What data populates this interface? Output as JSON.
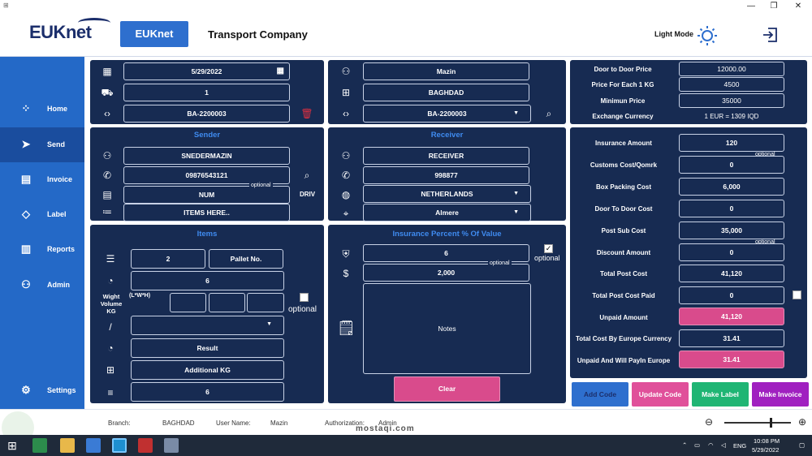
{
  "window": {
    "min": "—",
    "max": "❐",
    "close": "✕"
  },
  "header": {
    "logo": "EUKnet",
    "button": "EUKnet",
    "title": "Transport Company",
    "light_mode": "Light Mode"
  },
  "sidebar": {
    "items": [
      {
        "label": "Home",
        "icon": "⁘"
      },
      {
        "label": "Send",
        "icon": "➤"
      },
      {
        "label": "Invoice",
        "icon": "▤"
      },
      {
        "label": "Label",
        "icon": "◇"
      },
      {
        "label": "Reports",
        "icon": "▥"
      },
      {
        "label": "Admin",
        "icon": "⚇"
      },
      {
        "label": "Settings",
        "icon": "⚙"
      }
    ]
  },
  "top_left": {
    "date": "5/29/2022",
    "count": "1",
    "code": "BA-2200003"
  },
  "top_mid": {
    "user": "Mazin",
    "branch": "BAGHDAD",
    "code": "BA-2200003"
  },
  "prices": {
    "door_label": "Door to Door Price",
    "door_value": "12000.00",
    "per_kg_label": "Price For Each 1 KG",
    "per_kg_value": "4500",
    "min_label": "Minimun Price",
    "min_value": "35000",
    "exchange_label": "Exchange Currency",
    "exchange_value": "1 EUR = 1309 IQD"
  },
  "sender": {
    "title": "Sender",
    "name": "SNEDERMAZIN",
    "phone": "09876543121",
    "num": "NUM",
    "optional": "optional",
    "driv": "DRIV",
    "items": "ITEMS HERE.."
  },
  "receiver": {
    "title": "Receiver",
    "name": "RECEIVER",
    "phone": "998877",
    "country": "NETHERLANDS",
    "city": "Almere"
  },
  "items": {
    "title": "Items",
    "count": "2",
    "pallet": "Pallet No.",
    "weight": "6",
    "weight_label": "Wight Volume KG",
    "lwh": "(L*W*H)",
    "optional": "optional",
    "slash": "/",
    "result": "Result",
    "additional": "Additional KG",
    "total": "6"
  },
  "insurance": {
    "title": "Insurance Percent % Of Value",
    "percent": "6",
    "optional_chk": "optional",
    "value": "2,000",
    "optional": "optional",
    "notes": "Notes",
    "clear": "Clear"
  },
  "costs": {
    "rows": [
      {
        "label": "Insurance Amount",
        "value": "120"
      },
      {
        "label": "Customs Cost/Qomrk",
        "value": "0"
      },
      {
        "label": "Box Packing Cost",
        "value": "6,000"
      },
      {
        "label": "Door To Door Cost",
        "value": "0"
      },
      {
        "label": "Post Sub Cost",
        "value": "35,000"
      },
      {
        "label": "Discount Amount",
        "value": "0"
      },
      {
        "label": "Total Post Cost",
        "value": "41,120"
      },
      {
        "label": "Total Post Cost Paid",
        "value": "0"
      },
      {
        "label": "Unpaid Amount",
        "value": "41,120"
      },
      {
        "label": "Total Cost By Europe Currency",
        "value": "31.41"
      },
      {
        "label": "Unpaid And Will PayIn Europe",
        "value": "31.41"
      }
    ],
    "optional": "optional"
  },
  "actions": {
    "add": "Add Code",
    "update": "Update Code",
    "label": "Make Label",
    "invoice": "Make Invoice"
  },
  "status": {
    "branch_label": "Branch:",
    "branch": "BAGHDAD",
    "user_label": "User Name:",
    "user": "Mazin",
    "auth_label": "Authorization:",
    "auth": "Admin",
    "zoom_level": 0.7
  },
  "taskbar": {
    "time": "10:08 PM",
    "date": "5/29/2022",
    "lang": "ENG"
  },
  "watermark": "mostaqi.com",
  "colors": {
    "accent": "#2e6fce",
    "panel": "#172b52",
    "pink": "#d94b8c",
    "green": "#1fb574",
    "purple": "#a020c0",
    "blue_btn": "#2e6fce"
  }
}
